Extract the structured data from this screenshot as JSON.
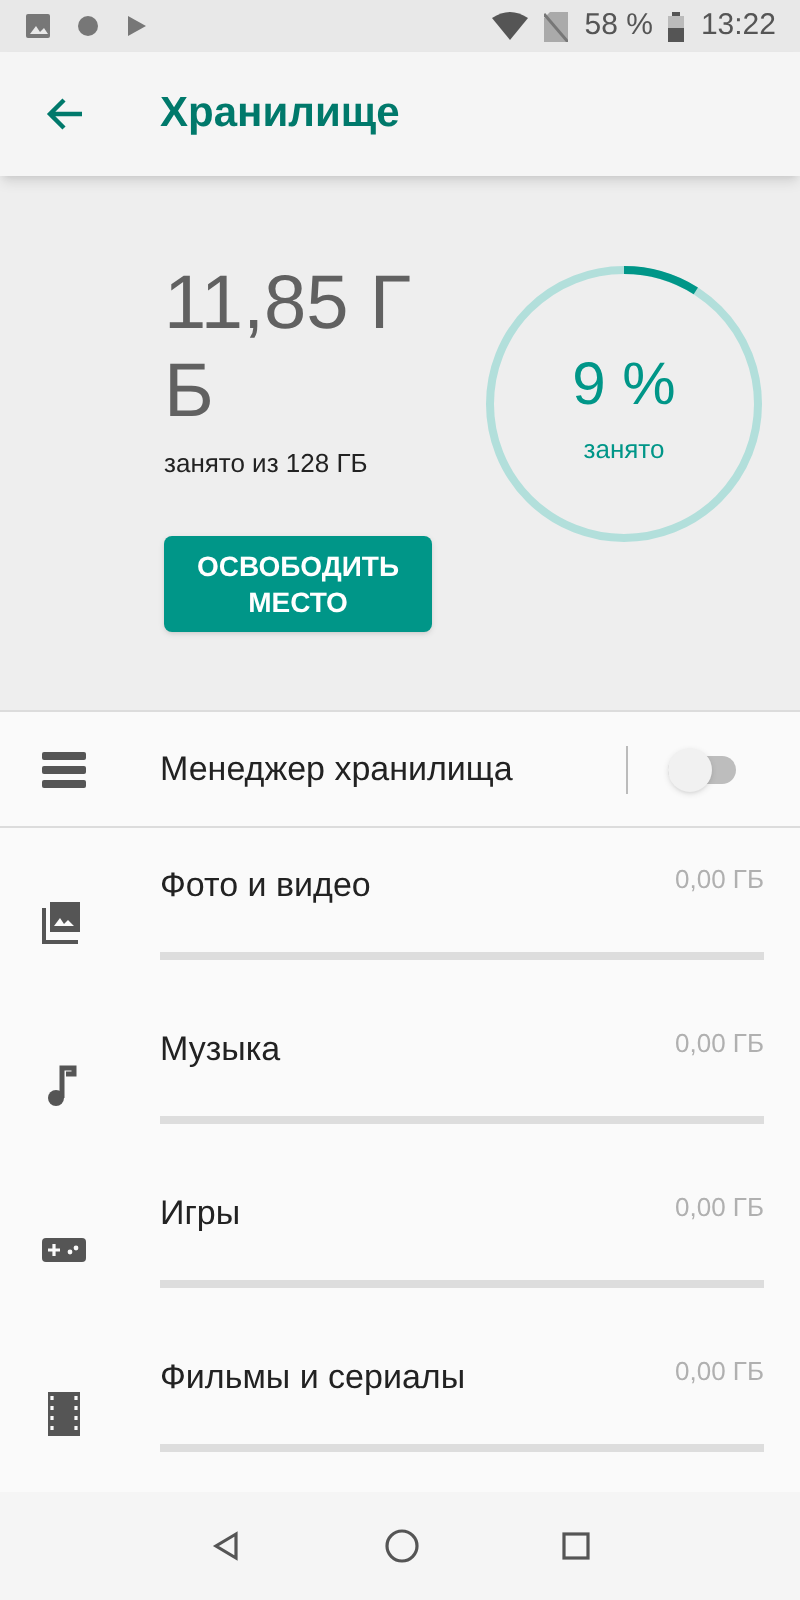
{
  "status_bar": {
    "battery": "58 %",
    "time": "13:22"
  },
  "app_bar": {
    "title": "Хранилище"
  },
  "summary": {
    "used": "11,85 ГБ",
    "caption": "занято из 128 ГБ",
    "percent": "9 %",
    "percent_caption": "занято",
    "level": 0.09,
    "button": "ОСВОБОДИТЬ МЕСТО"
  },
  "manager": {
    "label": "Менеджер хранилища",
    "on": false
  },
  "categories": [
    {
      "kind": "photo",
      "label": "Фото и видео",
      "size": "0,00 ГБ",
      "level": 0
    },
    {
      "kind": "music",
      "label": "Музыка",
      "size": "0,00 ГБ",
      "level": 0
    },
    {
      "kind": "games",
      "label": "Игры",
      "size": "0,00 ГБ",
      "level": 0
    },
    {
      "kind": "movies",
      "label": "Фильмы и сериалы",
      "size": "0,00 ГБ",
      "level": 0
    }
  ]
}
